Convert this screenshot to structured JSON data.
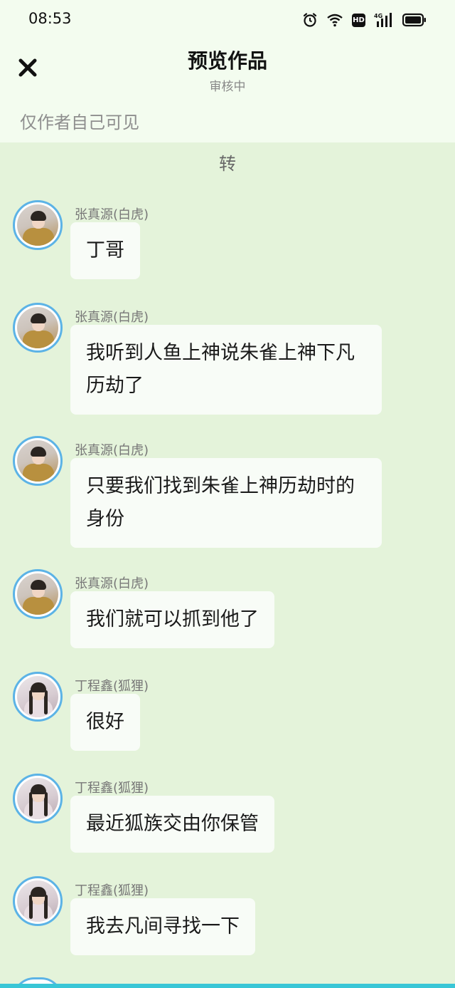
{
  "status_bar": {
    "time": "08:53",
    "icons": [
      "alarm-icon",
      "wifi-icon",
      "hd-icon",
      "signal-4g-icon",
      "battery-icon"
    ],
    "hd_label": "HD",
    "network_label": "4G"
  },
  "header": {
    "close_icon": "close-icon",
    "title": "预览作品",
    "subtitle": "审核中",
    "visibility_note": "仅作者自己可见"
  },
  "chat": {
    "heading": "转",
    "messages": [
      {
        "sender": "张真源(白虎)",
        "avatar": "zhang",
        "text": "丁哥"
      },
      {
        "sender": "张真源(白虎)",
        "avatar": "zhang",
        "text": "我听到人鱼上神说朱雀上神下凡历劫了"
      },
      {
        "sender": "张真源(白虎)",
        "avatar": "zhang",
        "text": "只要我们找到朱雀上神历劫时的身份"
      },
      {
        "sender": "张真源(白虎)",
        "avatar": "zhang",
        "text": "我们就可以抓到他了"
      },
      {
        "sender": "丁程鑫(狐狸)",
        "avatar": "ding",
        "text": "很好"
      },
      {
        "sender": "丁程鑫(狐狸)",
        "avatar": "ding",
        "text": "最近狐族交由你保管"
      },
      {
        "sender": "丁程鑫(狐狸)",
        "avatar": "ding",
        "text": "我去凡间寻找一下"
      }
    ]
  },
  "colors": {
    "page_background": "#e4f3da",
    "header_background": "#f3fcef",
    "bubble_background": "#f8fcf7",
    "avatar_ring": "#5cb3e6",
    "bottom_strip": "#39c6d6"
  }
}
